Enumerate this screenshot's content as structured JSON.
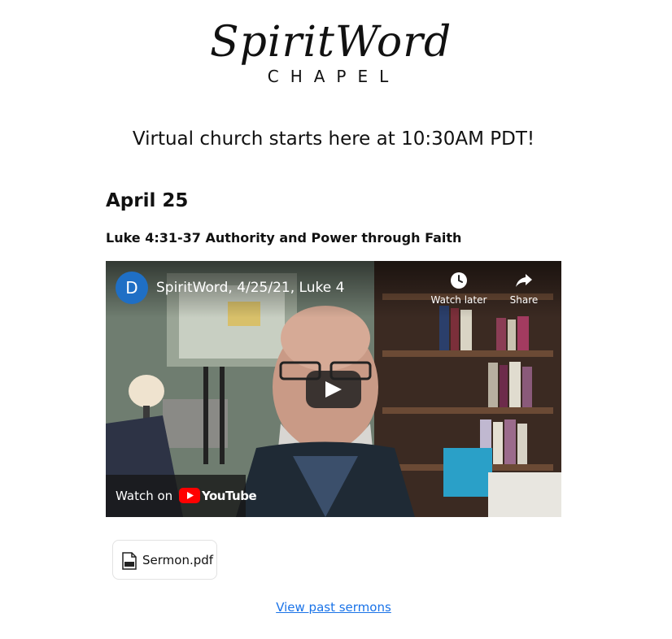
{
  "logo": {
    "line1": "SpiritWord",
    "line2": "CHAPEL"
  },
  "tagline": "Virtual church starts here at 10:30AM PDT!",
  "sermon": {
    "date": "April 25",
    "title": "Luke 4:31-37 Authority and Power through Faith"
  },
  "video": {
    "channel_initial": "D",
    "title": "SpiritWord, 4/25/21, Luke 4",
    "watch_later_label": "Watch later",
    "share_label": "Share",
    "watch_on_label": "Watch on",
    "youtube_label": "YouTube",
    "icons": [
      "clock-icon",
      "share-arrow-icon",
      "play-icon",
      "youtube-logo-icon"
    ]
  },
  "attachment": {
    "filename": "Sermon.pdf",
    "icon": "pdf-file-icon"
  },
  "past_sermons_link": "View past sermons",
  "colors": {
    "link": "#1a73e8",
    "avatar": "#1f6fc5",
    "youtube_red": "#ff0000"
  }
}
